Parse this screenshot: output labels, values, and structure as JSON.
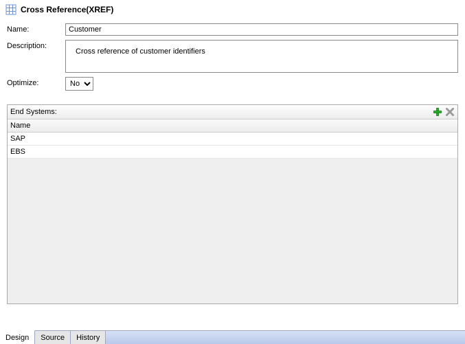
{
  "header": {
    "title": "Cross Reference(XREF)"
  },
  "form": {
    "name_label": "Name:",
    "name_value": "Customer",
    "description_label": "Description:",
    "description_value": "Cross reference of customer identifiers",
    "optimize_label": "Optimize:",
    "optimize_value": "No"
  },
  "panel": {
    "title": "End Systems:",
    "column_header": "Name",
    "rows": [
      "SAP",
      "EBS"
    ]
  },
  "tabs": {
    "design": "Design",
    "source": "Source",
    "history": "History"
  }
}
